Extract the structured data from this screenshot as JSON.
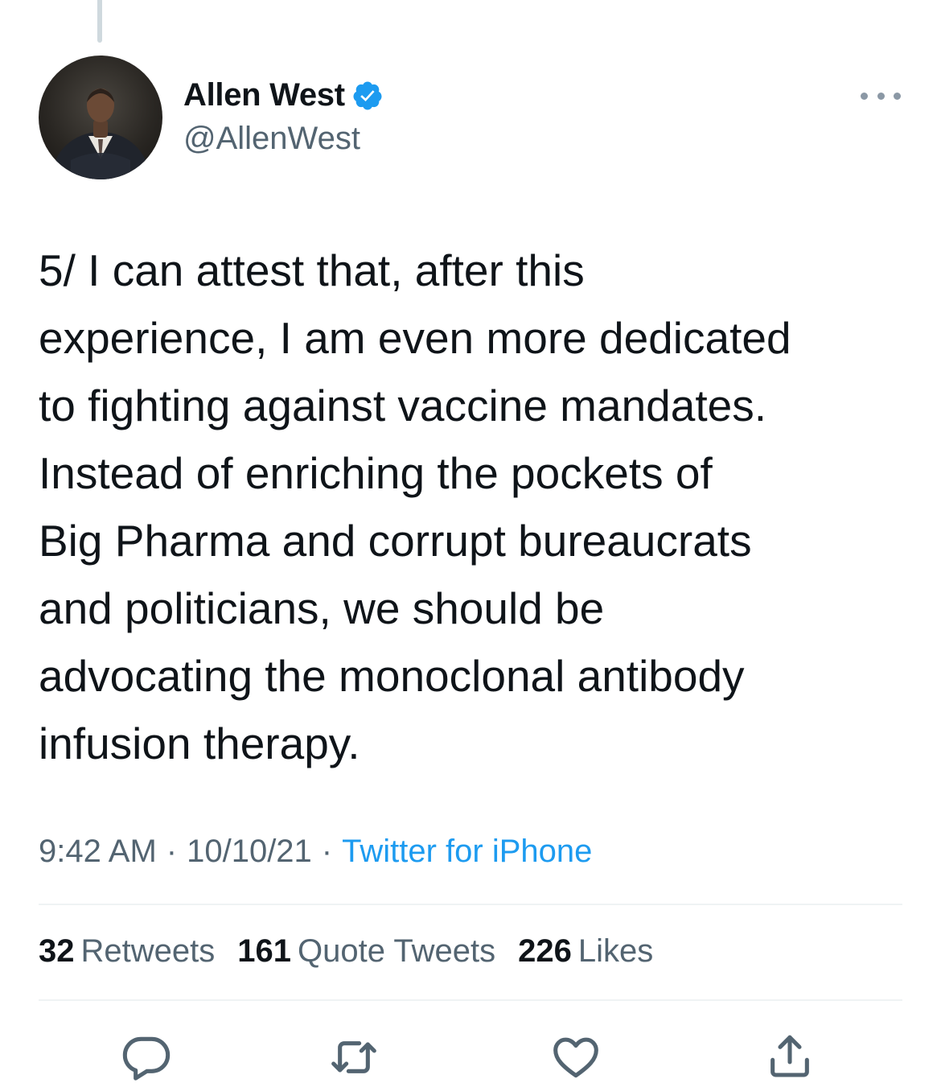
{
  "author": {
    "display_name": "Allen West",
    "handle": "@AllenWest",
    "verified": true
  },
  "tweet": {
    "text": "5/ I can attest that, after this\nexperience, I am even more dedicated\nto fighting against vaccine mandates.\nInstead of enriching the pockets of\nBig Pharma and corrupt bureaucrats\nand politicians, we should be\nadvocating the monoclonal antibody\ninfusion therapy.",
    "time": "9:42 AM",
    "date": "10/10/21",
    "separator": "·",
    "source": "Twitter for iPhone"
  },
  "stats": {
    "retweets_count": "32",
    "retweets_label": "Retweets",
    "quotes_count": "161",
    "quotes_label": "Quote Tweets",
    "likes_count": "226",
    "likes_label": "Likes"
  },
  "actions": [
    "reply-icon",
    "retweet-icon",
    "like-icon",
    "share-icon"
  ],
  "colors": {
    "text": "#0f1419",
    "secondary": "#536471",
    "link": "#1d9bf0",
    "divider": "#eff3f4"
  }
}
